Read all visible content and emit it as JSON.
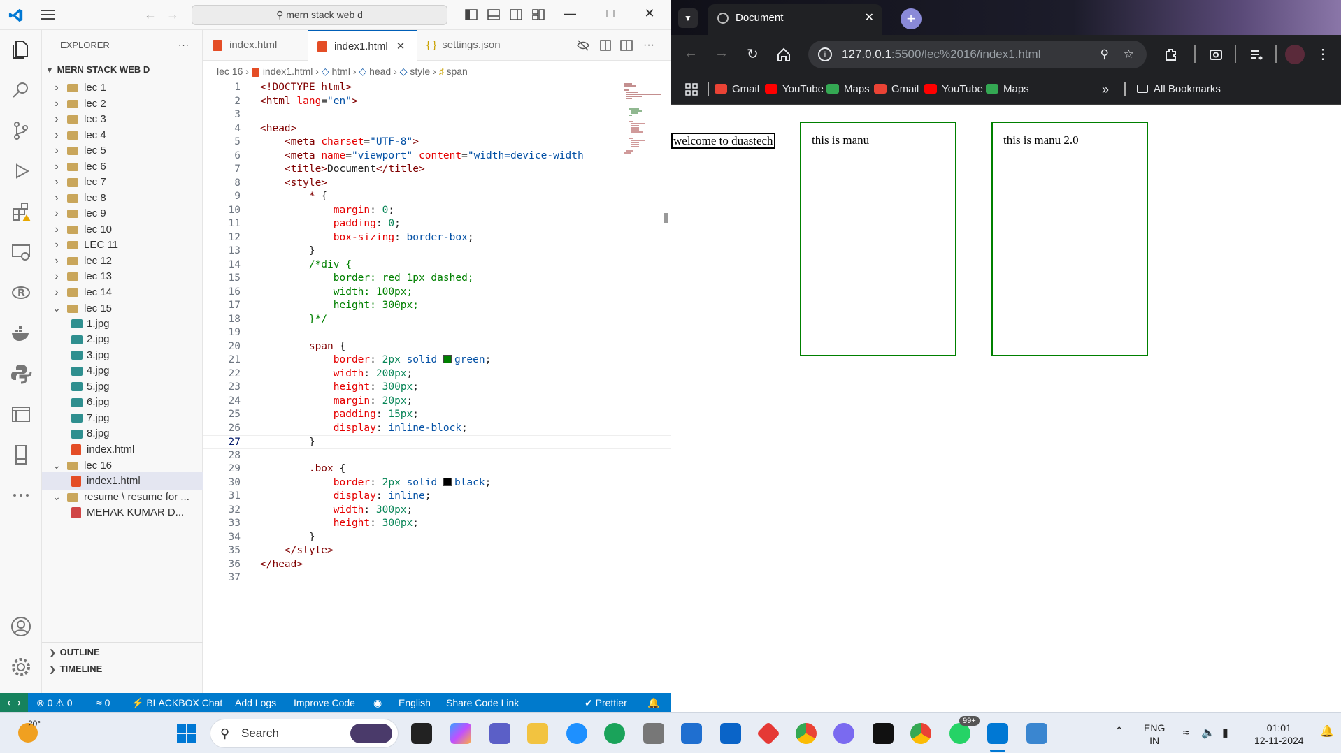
{
  "vscode": {
    "search_text": "mern stack web d",
    "explorer_label": "EXPLORER",
    "explorer_more": "···",
    "root_folder": "MERN STACK WEB D",
    "tree": [
      {
        "label": "lec 1",
        "type": "folder",
        "open": false
      },
      {
        "label": "lec 2",
        "type": "folder",
        "open": false
      },
      {
        "label": "lec 3",
        "type": "folder",
        "open": false
      },
      {
        "label": "lec 4",
        "type": "folder",
        "open": false
      },
      {
        "label": "lec 5",
        "type": "folder",
        "open": false
      },
      {
        "label": "lec 6",
        "type": "folder",
        "open": false
      },
      {
        "label": "lec 7",
        "type": "folder",
        "open": false
      },
      {
        "label": "lec 8",
        "type": "folder",
        "open": false
      },
      {
        "label": "lec 9",
        "type": "folder",
        "open": false
      },
      {
        "label": "lec 10",
        "type": "folder",
        "open": false
      },
      {
        "label": "LEC 11",
        "type": "folder",
        "open": false
      },
      {
        "label": "lec 12",
        "type": "folder",
        "open": false
      },
      {
        "label": "lec 13",
        "type": "folder",
        "open": false
      },
      {
        "label": "lec 14",
        "type": "folder",
        "open": false
      },
      {
        "label": "lec 15",
        "type": "folder",
        "open": true
      },
      {
        "label": "1.jpg",
        "type": "image"
      },
      {
        "label": "2.jpg",
        "type": "image"
      },
      {
        "label": "3.jpg",
        "type": "image"
      },
      {
        "label": "4.jpg",
        "type": "image"
      },
      {
        "label": "5.jpg",
        "type": "image"
      },
      {
        "label": "6.jpg",
        "type": "image"
      },
      {
        "label": "7.jpg",
        "type": "image"
      },
      {
        "label": "8.jpg",
        "type": "image"
      },
      {
        "label": "index.html",
        "type": "html"
      },
      {
        "label": "lec 16",
        "type": "folder",
        "open": true
      },
      {
        "label": "index1.html",
        "type": "html",
        "selected": true
      },
      {
        "label": "resume \\ resume for ...",
        "type": "folder",
        "open": true
      },
      {
        "label": "MEHAK KUMAR D...",
        "type": "pdf"
      }
    ],
    "outline_label": "OUTLINE",
    "timeline_label": "TIMELINE",
    "tabs": [
      {
        "label": "index.html",
        "kind": "html",
        "active": false
      },
      {
        "label": "index1.html",
        "kind": "html",
        "active": true
      },
      {
        "label": "settings.json",
        "kind": "json",
        "active": false
      }
    ],
    "breadcrumb": [
      "lec 16",
      "index1.html",
      "html",
      "head",
      "style",
      "span"
    ],
    "status": {
      "remote_icon": "remote-icon",
      "problems": "⊗ 0 ⚠ 0",
      "ports": "0",
      "blackbox": "BLACKBOX Chat",
      "add_logs": "Add Logs",
      "improve_code": "Improve Code",
      "language": "English",
      "share": "Share Code Link",
      "prettier": "✔ Prettier"
    },
    "current_line": 27
  },
  "code_lines": [
    {
      "n": 1,
      "parts": [
        [
          "t-tag",
          "<!DOCTYPE html>"
        ]
      ]
    },
    {
      "n": 2,
      "parts": [
        [
          "t-tag",
          "<html "
        ],
        [
          "t-attr",
          "lang"
        ],
        [
          "code",
          "="
        ],
        [
          "t-str",
          "\"en\""
        ],
        [
          "t-tag",
          ">"
        ]
      ]
    },
    {
      "n": 3,
      "parts": []
    },
    {
      "n": 4,
      "parts": [
        [
          "t-tag",
          "<head>"
        ]
      ]
    },
    {
      "n": 5,
      "parts": [
        [
          "code",
          "    "
        ],
        [
          "t-tag",
          "<meta "
        ],
        [
          "t-attr",
          "charset"
        ],
        [
          "code",
          "="
        ],
        [
          "t-str",
          "\"UTF-8\""
        ],
        [
          "t-tag",
          ">"
        ]
      ]
    },
    {
      "n": 6,
      "parts": [
        [
          "code",
          "    "
        ],
        [
          "t-tag",
          "<meta "
        ],
        [
          "t-attr",
          "name"
        ],
        [
          "code",
          "="
        ],
        [
          "t-str",
          "\"viewport\""
        ],
        [
          "code",
          " "
        ],
        [
          "t-attr",
          "content"
        ],
        [
          "code",
          "="
        ],
        [
          "t-str",
          "\"width=device-width"
        ]
      ]
    },
    {
      "n": 7,
      "parts": [
        [
          "code",
          "    "
        ],
        [
          "t-tag",
          "<title>"
        ],
        [
          "code",
          "Document"
        ],
        [
          "t-tag",
          "</title>"
        ]
      ]
    },
    {
      "n": 8,
      "parts": [
        [
          "code",
          "    "
        ],
        [
          "t-tag",
          "<style>"
        ]
      ]
    },
    {
      "n": 9,
      "parts": [
        [
          "code",
          "        "
        ],
        [
          "t-tag",
          "*"
        ],
        [
          "code",
          " {"
        ]
      ]
    },
    {
      "n": 10,
      "parts": [
        [
          "code",
          "            "
        ],
        [
          "t-prop",
          "margin"
        ],
        [
          "code",
          ": "
        ],
        [
          "t-val",
          "0"
        ],
        [
          "code",
          ";"
        ]
      ]
    },
    {
      "n": 11,
      "parts": [
        [
          "code",
          "            "
        ],
        [
          "t-prop",
          "padding"
        ],
        [
          "code",
          ": "
        ],
        [
          "t-val",
          "0"
        ],
        [
          "code",
          ";"
        ]
      ]
    },
    {
      "n": 12,
      "parts": [
        [
          "code",
          "            "
        ],
        [
          "t-prop",
          "box-sizing"
        ],
        [
          "code",
          ": "
        ],
        [
          "t-kw",
          "border-box"
        ],
        [
          "code",
          ";"
        ]
      ]
    },
    {
      "n": 13,
      "parts": [
        [
          "code",
          "        }"
        ]
      ]
    },
    {
      "n": 14,
      "parts": [
        [
          "code",
          "        "
        ],
        [
          "t-cmt",
          "/*div {"
        ]
      ]
    },
    {
      "n": 15,
      "parts": [
        [
          "t-cmt",
          "            border: red 1px dashed;"
        ]
      ]
    },
    {
      "n": 16,
      "parts": [
        [
          "t-cmt",
          "            width: 100px;"
        ]
      ]
    },
    {
      "n": 17,
      "parts": [
        [
          "t-cmt",
          "            height: 300px;"
        ]
      ]
    },
    {
      "n": 18,
      "parts": [
        [
          "t-cmt",
          "        }*/"
        ]
      ]
    },
    {
      "n": 19,
      "parts": []
    },
    {
      "n": 20,
      "parts": [
        [
          "code",
          "        "
        ],
        [
          "t-tag",
          "span"
        ],
        [
          "code",
          " {"
        ]
      ]
    },
    {
      "n": 21,
      "parts": [
        [
          "code",
          "            "
        ],
        [
          "t-prop",
          "border"
        ],
        [
          "code",
          ": "
        ],
        [
          "t-val",
          "2px"
        ],
        [
          "code",
          " "
        ],
        [
          "t-kw",
          "solid"
        ],
        [
          "code",
          " "
        ],
        [
          "swatch",
          "#008000"
        ],
        [
          "t-kw",
          "green"
        ],
        [
          "code",
          ";"
        ]
      ]
    },
    {
      "n": 22,
      "parts": [
        [
          "code",
          "            "
        ],
        [
          "t-prop",
          "width"
        ],
        [
          "code",
          ": "
        ],
        [
          "t-val",
          "200px"
        ],
        [
          "code",
          ";"
        ]
      ]
    },
    {
      "n": 23,
      "parts": [
        [
          "code",
          "            "
        ],
        [
          "t-prop",
          "height"
        ],
        [
          "code",
          ": "
        ],
        [
          "t-val",
          "300px"
        ],
        [
          "code",
          ";"
        ]
      ]
    },
    {
      "n": 24,
      "parts": [
        [
          "code",
          "            "
        ],
        [
          "t-prop",
          "margin"
        ],
        [
          "code",
          ": "
        ],
        [
          "t-val",
          "20px"
        ],
        [
          "code",
          ";"
        ]
      ]
    },
    {
      "n": 25,
      "parts": [
        [
          "code",
          "            "
        ],
        [
          "t-prop",
          "padding"
        ],
        [
          "code",
          ": "
        ],
        [
          "t-val",
          "15px"
        ],
        [
          "code",
          ";"
        ]
      ]
    },
    {
      "n": 26,
      "parts": [
        [
          "code",
          "            "
        ],
        [
          "t-prop",
          "display"
        ],
        [
          "code",
          ": "
        ],
        [
          "t-kw",
          "inline-block"
        ],
        [
          "code",
          ";"
        ]
      ]
    },
    {
      "n": 27,
      "parts": [
        [
          "code",
          "        }"
        ]
      ]
    },
    {
      "n": 28,
      "parts": []
    },
    {
      "n": 29,
      "parts": [
        [
          "code",
          "        "
        ],
        [
          "t-tag",
          ".box"
        ],
        [
          "code",
          " {"
        ]
      ]
    },
    {
      "n": 30,
      "parts": [
        [
          "code",
          "            "
        ],
        [
          "t-prop",
          "border"
        ],
        [
          "code",
          ": "
        ],
        [
          "t-val",
          "2px"
        ],
        [
          "code",
          " "
        ],
        [
          "t-kw",
          "solid"
        ],
        [
          "code",
          " "
        ],
        [
          "swatch",
          "#000000"
        ],
        [
          "t-kw",
          "black"
        ],
        [
          "code",
          ";"
        ]
      ]
    },
    {
      "n": 31,
      "parts": [
        [
          "code",
          "            "
        ],
        [
          "t-prop",
          "display"
        ],
        [
          "code",
          ": "
        ],
        [
          "t-kw",
          "inline"
        ],
        [
          "code",
          ";"
        ]
      ]
    },
    {
      "n": 32,
      "parts": [
        [
          "code",
          "            "
        ],
        [
          "t-prop",
          "width"
        ],
        [
          "code",
          ": "
        ],
        [
          "t-val",
          "300px"
        ],
        [
          "code",
          ";"
        ]
      ]
    },
    {
      "n": 33,
      "parts": [
        [
          "code",
          "            "
        ],
        [
          "t-prop",
          "height"
        ],
        [
          "code",
          ": "
        ],
        [
          "t-val",
          "300px"
        ],
        [
          "code",
          ";"
        ]
      ]
    },
    {
      "n": 34,
      "parts": [
        [
          "code",
          "        }"
        ]
      ]
    },
    {
      "n": 35,
      "parts": [
        [
          "code",
          "    "
        ],
        [
          "t-tag",
          "</style>"
        ]
      ]
    },
    {
      "n": 36,
      "parts": [
        [
          "t-tag",
          "</head>"
        ]
      ]
    },
    {
      "n": 37,
      "parts": []
    }
  ],
  "chrome": {
    "tab_title": "Document",
    "url_host": "127.0.0.1",
    "url_path": ":5500/lec%2016/index1.html",
    "bookmarks": [
      {
        "label": "Gmail",
        "color": "#ea4335"
      },
      {
        "label": "YouTube",
        "color": "#ff0000"
      },
      {
        "label": "Maps",
        "color": "#34a853"
      },
      {
        "label": "Gmail",
        "color": "#ea4335"
      },
      {
        "label": "YouTube",
        "color": "#ff0000"
      },
      {
        "label": "Maps",
        "color": "#34a853"
      }
    ],
    "more_bookmarks": "»",
    "all_bookmarks": "All Bookmarks"
  },
  "page": {
    "welcome": "welcome to duastech",
    "box1": "this is manu",
    "box2": "this is manu 2.0"
  },
  "taskbar": {
    "weather": "20°",
    "search": "Search",
    "lang_top": "ENG",
    "lang_bottom": "IN",
    "time": "01:01",
    "date": "12-11-2024",
    "badge": "99+"
  }
}
